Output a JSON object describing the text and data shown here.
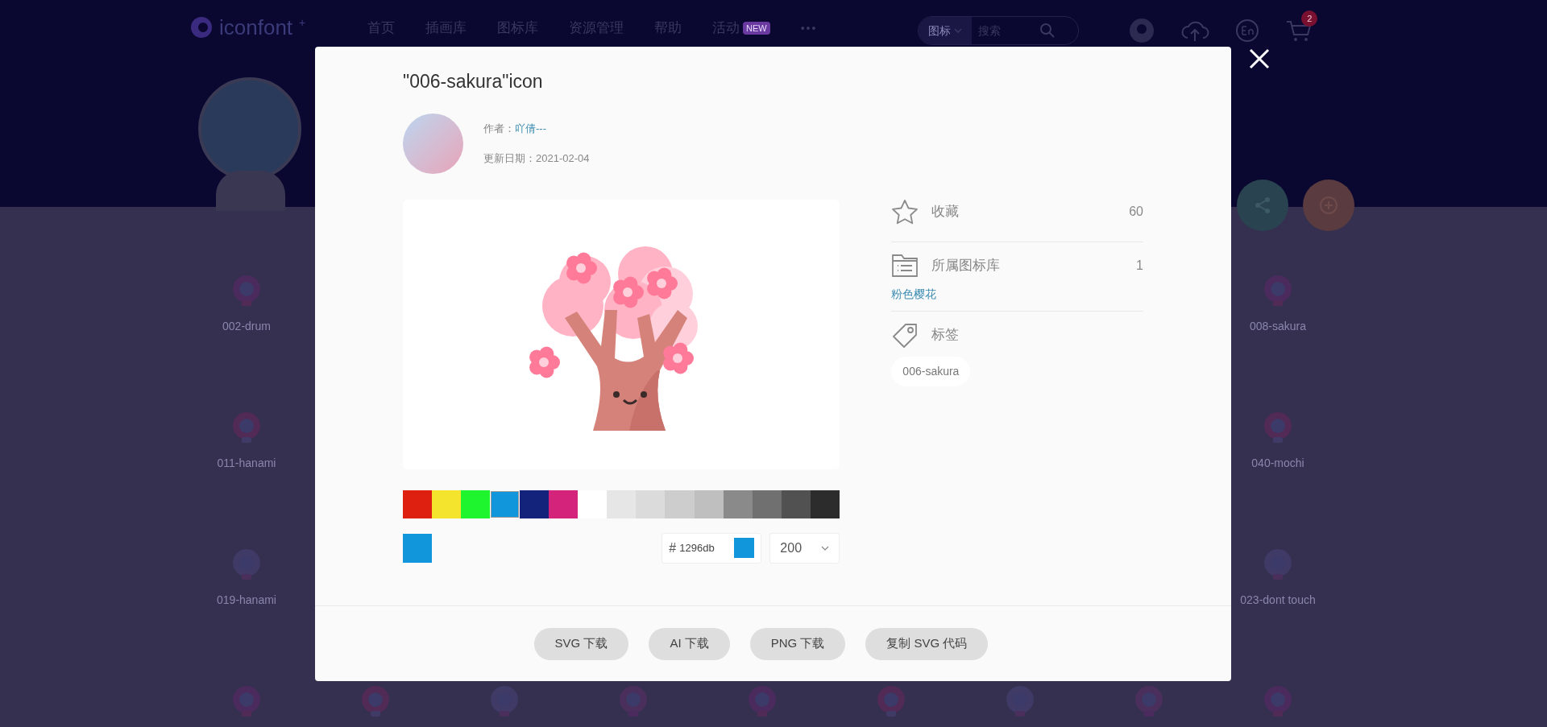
{
  "header": {
    "logo": "iconfont",
    "logo_mark": "+",
    "nav": [
      {
        "label": "首页"
      },
      {
        "label": "插画库"
      },
      {
        "label": "图标库"
      },
      {
        "label": "资源管理"
      },
      {
        "label": "帮助"
      },
      {
        "label": "活动",
        "badge": "NEW"
      }
    ],
    "more": "•••",
    "search": {
      "scope": "图标",
      "placeholder": "搜索"
    },
    "cart_count": "2"
  },
  "icon_grid": {
    "rows": [
      {
        "first": "002-drum",
        "last": "008-sakura"
      },
      {
        "first": "011-hanami",
        "last": "040-mochi"
      },
      {
        "first": "019-hanami",
        "last": "023-dont touch"
      }
    ]
  },
  "modal": {
    "title": "\"006-sakura\"icon",
    "author_label": "作者：",
    "author": "吖倩---",
    "date_label": "更新日期：",
    "date": "2021-02-04",
    "palette": [
      {
        "color": "#dd2010",
        "selected": false
      },
      {
        "color": "#f5e42e",
        "selected": false
      },
      {
        "color": "#1ef52e",
        "selected": false
      },
      {
        "color": "#1296db",
        "selected": true
      },
      {
        "color": "#13227a",
        "selected": false
      },
      {
        "color": "#d4237a",
        "selected": false
      },
      {
        "color": "#ffffff",
        "selected": false
      },
      {
        "color": "#e6e6e6",
        "selected": false
      },
      {
        "color": "#dbdbdb",
        "selected": false
      },
      {
        "color": "#cdcdcd",
        "selected": false
      },
      {
        "color": "#bfbfbf",
        "selected": false
      },
      {
        "color": "#8a8a8a",
        "selected": false
      },
      {
        "color": "#707070",
        "selected": false
      },
      {
        "color": "#515151",
        "selected": false
      },
      {
        "color": "#2c2c2c",
        "selected": false
      }
    ],
    "hash_label": "#",
    "hex_value": "1296db",
    "size": "200",
    "info": [
      {
        "kind": "star",
        "label": "收藏",
        "count": "60"
      },
      {
        "kind": "library",
        "label": "所属图标库",
        "count": "1",
        "link": "粉色樱花"
      },
      {
        "kind": "tag",
        "label": "标签",
        "tags": [
          "006-sakura"
        ]
      }
    ],
    "buttons": [
      "SVG 下载",
      "AI 下载",
      "PNG 下载",
      "复制 SVG 代码"
    ]
  }
}
